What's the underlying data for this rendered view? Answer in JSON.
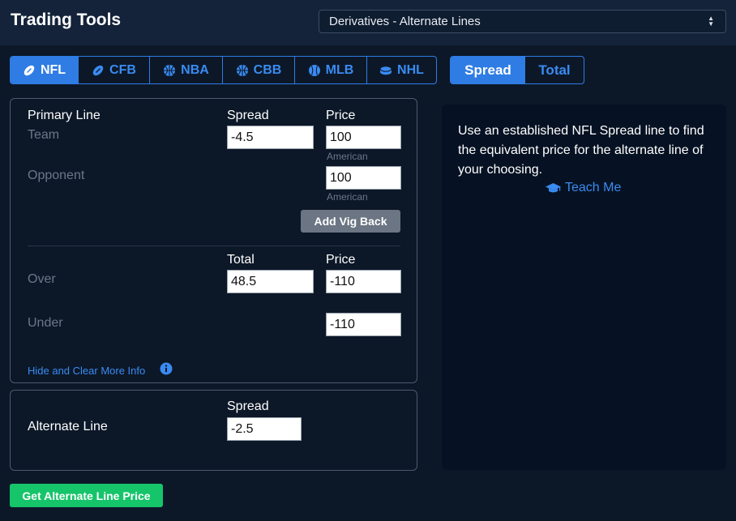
{
  "header": {
    "title": "Trading Tools",
    "tool_select_value": "Derivatives - Alternate Lines"
  },
  "sport_tabs": [
    {
      "label": "NFL",
      "icon": "football-icon",
      "active": true
    },
    {
      "label": "CFB",
      "icon": "football-icon",
      "active": false
    },
    {
      "label": "NBA",
      "icon": "basketball-icon",
      "active": false
    },
    {
      "label": "CBB",
      "icon": "basketball-icon",
      "active": false
    },
    {
      "label": "MLB",
      "icon": "baseball-icon",
      "active": false
    },
    {
      "label": "NHL",
      "icon": "hockey-puck-icon",
      "active": false
    }
  ],
  "type_tabs": [
    {
      "label": "Spread",
      "active": true
    },
    {
      "label": "Total",
      "active": false
    }
  ],
  "primary": {
    "heading": "Primary Line",
    "spread_header": "Spread",
    "price_header": "Price",
    "team_label": "Team",
    "team_spread": "-4.5",
    "team_price": "100",
    "team_price_format": "American",
    "opponent_label": "Opponent",
    "opponent_price": "100",
    "opponent_price_format": "American",
    "add_vig_label": "Add Vig Back",
    "total_header": "Total",
    "total_price_header": "Price",
    "over_label": "Over",
    "over_total": "48.5",
    "over_price": "-110",
    "under_label": "Under",
    "under_price": "-110",
    "more_info_link": "Hide and Clear More Info"
  },
  "alternate": {
    "spread_header": "Spread",
    "label": "Alternate Line",
    "spread_value": "-2.5"
  },
  "info": {
    "text": "Use an established NFL Spread line to find the equivalent price for the alternate line of your choosing.",
    "teach_me": "Teach Me"
  },
  "get_price_button": "Get Alternate Line Price",
  "colors": {
    "accent": "#2f7ce4",
    "success": "#16c46a",
    "background": "#0c1828"
  }
}
